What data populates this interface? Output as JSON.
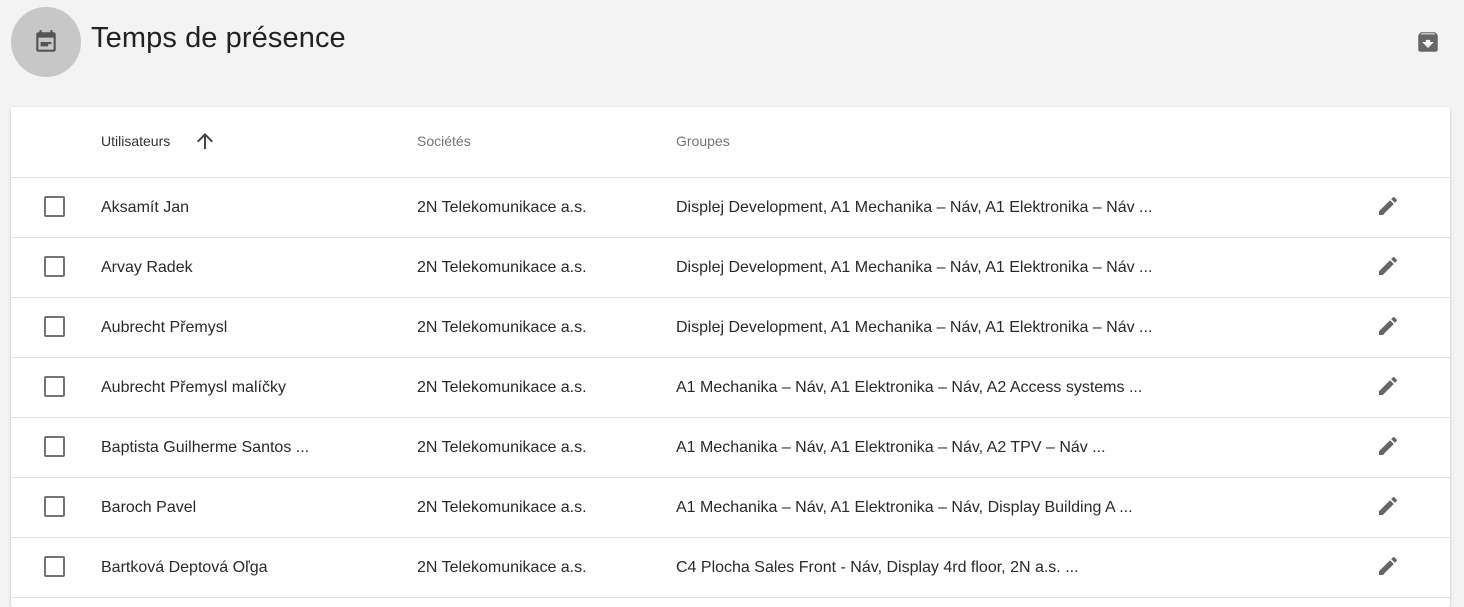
{
  "header": {
    "title": "Temps de présence",
    "page_icon": "calendar-note-icon",
    "export_icon": "archive-download-icon"
  },
  "table": {
    "columns": {
      "users": "Utilisateurs",
      "companies": "Sociétés",
      "groups": "Groupes"
    },
    "sort": {
      "column": "users",
      "direction": "ascending",
      "icon": "arrow-up-icon"
    },
    "rows": [
      {
        "user": "Aksamít Jan",
        "company": "2N Telekomunikace a.s.",
        "groups": "Displej Development, A1 Mechanika – Náv, A1 Elektronika – Náv ..."
      },
      {
        "user": "Arvay Radek",
        "company": "2N Telekomunikace a.s.",
        "groups": "Displej Development, A1 Mechanika – Náv, A1 Elektronika – Náv ..."
      },
      {
        "user": "Aubrecht Přemysl",
        "company": "2N Telekomunikace a.s.",
        "groups": "Displej Development, A1 Mechanika – Náv, A1 Elektronika – Náv ..."
      },
      {
        "user": "Aubrecht Přemysl malíčky",
        "company": "2N Telekomunikace a.s.",
        "groups": "A1 Mechanika – Náv, A1 Elektronika – Náv, A2 Access systems ..."
      },
      {
        "user": "Baptista Guilherme Santos ...",
        "company": "2N Telekomunikace a.s.",
        "groups": "A1 Mechanika – Náv, A1 Elektronika – Náv, A2 TPV – Náv ..."
      },
      {
        "user": "Baroch Pavel",
        "company": "2N Telekomunikace a.s.",
        "groups": "A1 Mechanika – Náv, A1 Elektronika – Náv, Display Building A ..."
      },
      {
        "user": "Bartková Deptová Oľga",
        "company": "2N Telekomunikace a.s.",
        "groups": "C4 Plocha Sales Front - Náv, Display 4rd floor, 2N a.s. ..."
      }
    ],
    "row_icon": "pencil-edit-icon"
  },
  "colors": {
    "background": "#f3f3f3",
    "card": "#ffffff",
    "icon_circle": "#c7c7c7",
    "icon": "#666666"
  }
}
